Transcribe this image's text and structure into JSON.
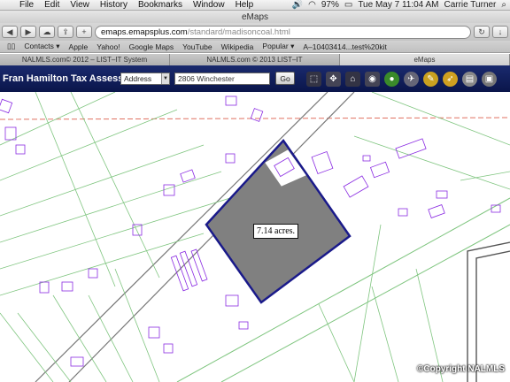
{
  "menubar": {
    "items": [
      "File",
      "Edit",
      "View",
      "History",
      "Bookmarks",
      "Window",
      "Help"
    ],
    "battery": "97%",
    "clock": "Tue May 7  11:04 AM",
    "user": "Carrie Turner"
  },
  "window": {
    "title": "eMaps"
  },
  "toolbar": {
    "url_host": "emaps.emapsplus.com",
    "url_path": "/standard/madisoncoal.html"
  },
  "bookmarks": [
    "Contacts ▾",
    "Apple",
    "Yahoo!",
    "Google Maps",
    "YouTube",
    "Wikipedia",
    "Popular ▾",
    "A–10403414...test%20kit"
  ],
  "tabs": [
    {
      "label": "NALMLS.com© 2012 – LIST–IT System",
      "active": false
    },
    {
      "label": "NALMLS.com © 2013 LIST–IT",
      "active": false
    },
    {
      "label": "eMaps",
      "active": true
    }
  ],
  "header": {
    "title": "Fran Hamilton Tax Assessor...",
    "search_type": "Address",
    "search_value": "2806 Winchester",
    "go_label": "Go"
  },
  "tools": [
    "select-icon",
    "pan-icon",
    "home-icon",
    "zoom-icon",
    "globe-icon",
    "identify-icon",
    "measure-icon",
    "ruler-icon",
    "print-icon",
    "clear-icon"
  ],
  "map": {
    "parcel_label": "7.14 acres.",
    "copyright": "©Copyright NALMLS",
    "parcel_fill": "#808080",
    "parcel_border": "#1a1a8a",
    "line_color": "#7fc57f",
    "building_color": "#8a2be2",
    "boundary_color": "#e07060"
  }
}
